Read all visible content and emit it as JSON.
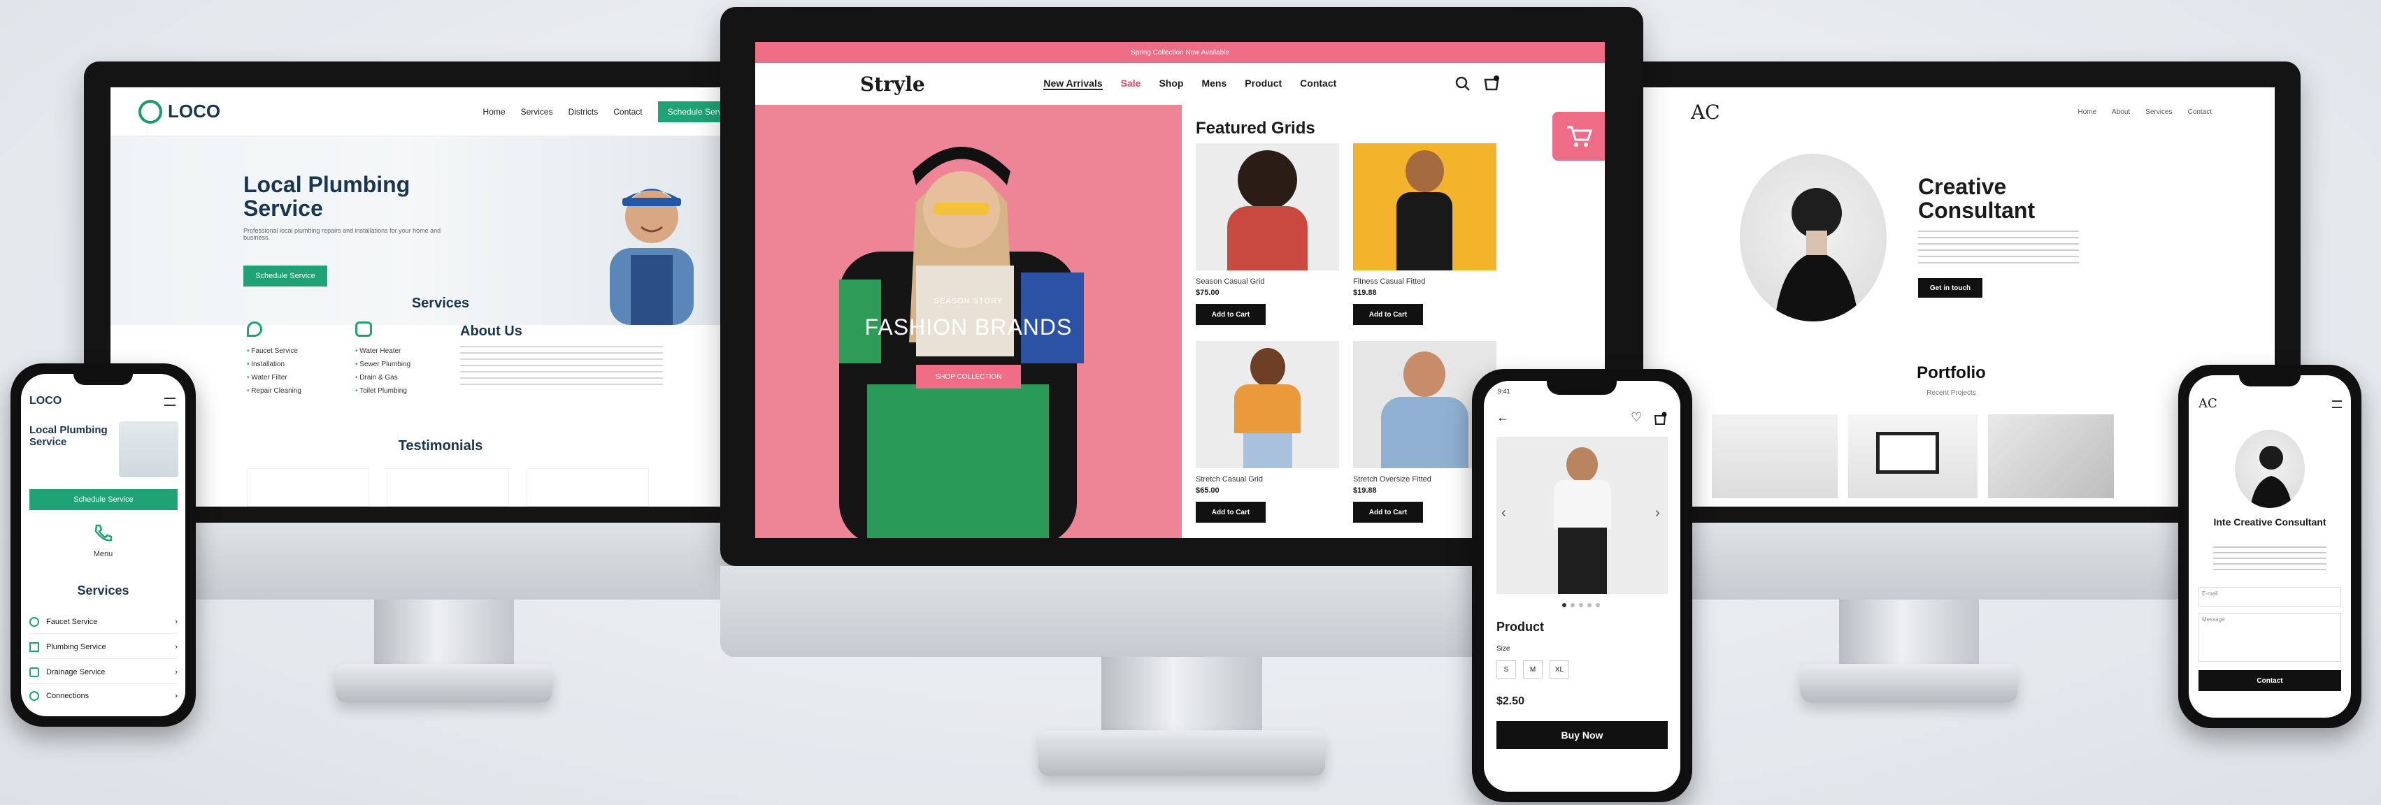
{
  "plumbing": {
    "logo": "LOCO",
    "nav": [
      "Home",
      "Services",
      "Districts",
      "Contact"
    ],
    "nav_cta": "Schedule Service",
    "hero_title": "Local Plumbing Service",
    "hero_button": "Schedule Service",
    "services_title": "Services",
    "about_title": "About Us",
    "col1": [
      "Faucet Service",
      "Installation",
      "Water Filter",
      "Repair Cleaning"
    ],
    "col2": [
      "Water Heater",
      "Sewer Plumbing",
      "Drain & Gas",
      "Toilet Plumbing"
    ],
    "testimonials_title": "Testimonials"
  },
  "fashion": {
    "banner": "Spring Collection Now Available",
    "brand": "Stryle",
    "nav": [
      "New Arrivals",
      "Sale",
      "Shop",
      "Mens",
      "Product",
      "Contact"
    ],
    "hero_kicker": "SEASON STORY",
    "hero_title": "FASHION BRANDS",
    "hero_button": "SHOP COLLECTION",
    "grid_title": "Featured Grids",
    "products": [
      {
        "name": "Season Casual Grid",
        "price": "$75.00",
        "button": "Add to Cart"
      },
      {
        "name": "Fitness Casual Fitted",
        "price": "$19.88",
        "button": "Add to Cart"
      },
      {
        "name": "Stretch Casual Grid",
        "price": "$65.00",
        "button": "Add to Cart"
      },
      {
        "name": "Stretch Oversize Fitted",
        "price": "$19.88",
        "button": "Add to Cart"
      }
    ]
  },
  "consultant": {
    "logo": "AC",
    "nav": [
      "Home",
      "About",
      "Services",
      "Contact"
    ],
    "hero_title": "Creative Consultant",
    "hero_button": "Get in touch",
    "portfolio_title": "Portfolio",
    "portfolio_sub": "Recent Projects"
  },
  "phone_plumbing": {
    "logo": "LOCO",
    "hero_title": "Local Plumbing Service",
    "cta": "Schedule Service",
    "mid_label": "Menu",
    "services_title": "Services",
    "items": [
      "Faucet Service",
      "Plumbing Service",
      "Drainage Service",
      "Connections"
    ]
  },
  "phone_product": {
    "time": "9:41",
    "title": "Product",
    "size_label": "Size",
    "sizes": [
      "S",
      "M",
      "XL"
    ],
    "price": "$2.50",
    "buy": "Buy Now"
  },
  "phone_consultant": {
    "logo": "AC",
    "title": "Inte Creative Consultant",
    "field1": "E-mail",
    "field2": "Message",
    "button": "Contact"
  },
  "colors": {
    "green": "#1fa275",
    "pink": "#ee8596",
    "accent_pink": "#ef6c86",
    "dark": "#111111"
  }
}
